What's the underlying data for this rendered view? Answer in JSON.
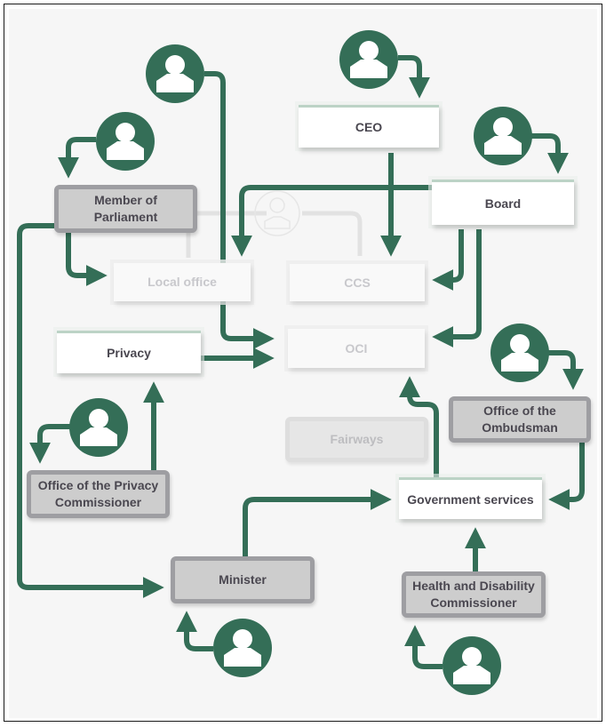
{
  "colors": {
    "accent": "#346e57",
    "primary_box": "#ffffff",
    "oversight_box": "#cdcdcd",
    "faded_text": "#c8c8cc",
    "text": "#4a4750",
    "background": "#f6f6f6"
  },
  "nodes": {
    "ceo": "CEO",
    "board": "Board",
    "member_of_parliament": "Member of Parliament",
    "local_office": "Local office",
    "ccs": "CCS",
    "privacy": "Privacy",
    "oci": "OCI",
    "fairways": "Fairways",
    "office_of_the_ombudsman": "Office of the Ombudsman",
    "office_of_the_privacy_commissioner": "Office of the Privacy Commissioner",
    "government_services": "Government services",
    "minister": "Minister",
    "health_and_disability_commissioner": "Health and Disability Commissioner"
  },
  "icons": {
    "person": "person-icon"
  }
}
